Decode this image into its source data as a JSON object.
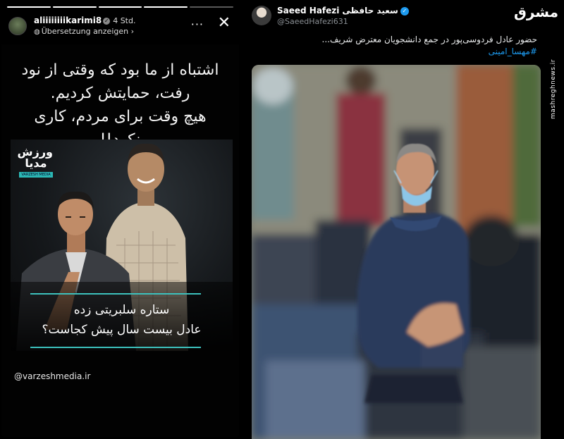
{
  "story": {
    "username": "aliiiiiiiikarimi8",
    "time": "4 Std.",
    "translate": "Übersetzung anzeigen",
    "headline_lines": [
      "اشتباه از ما بود که وقتی از نود",
      "رفت، حمایتش کردیم.",
      "هیچ وقت برای مردم، کاری نکرد!!"
    ],
    "card": {
      "logo_text": "ورزش مدیا",
      "logo_sub": "VARZESH MEDIA",
      "caption_1": "ستاره سلبریتی زده",
      "caption_2": "عادل بیست سال پیش کجاست؟"
    },
    "mention": "@varzeshmedia.ir",
    "accent_color": "#3cc1bd"
  },
  "tweet": {
    "name": "Saeed Hafezi",
    "name_fa": "سعید حافظی",
    "handle": "@SaeedHafezi631",
    "text": "حضور عادل فردوسی‌پور در جمع دانشجویان معترض شریف...",
    "hashtag": "#مهسا_امینی",
    "verified_color": "#1d9bf0",
    "hashtag_color": "#1d9bf0"
  },
  "watermark": {
    "logo": "مشرق",
    "url": "mashreghnews.ir"
  },
  "icons": {
    "more": "more-icon",
    "close": "close-icon",
    "verified": "verified-badge-icon",
    "translate": "globe-icon"
  }
}
